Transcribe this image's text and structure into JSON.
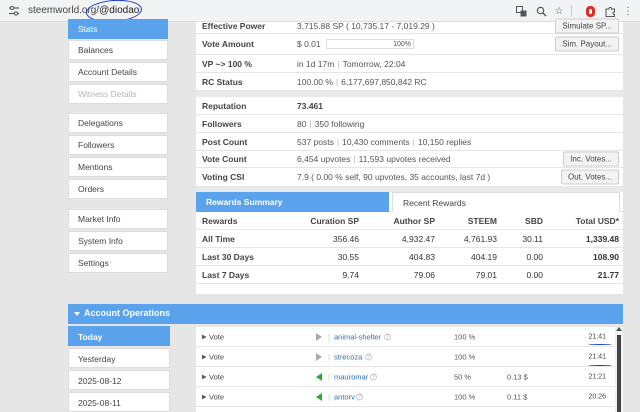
{
  "browser": {
    "url_host": "steemworld.org/",
    "url_path": "@diodao"
  },
  "sidebar": {
    "items": [
      {
        "label": "Stats"
      },
      {
        "label": "Balances"
      },
      {
        "label": "Account Details"
      },
      {
        "label": "Witness Details"
      },
      {
        "label": "Delegations"
      },
      {
        "label": "Followers"
      },
      {
        "label": "Mentions"
      },
      {
        "label": "Orders"
      },
      {
        "label": "Market Info"
      },
      {
        "label": "System Info"
      },
      {
        "label": "Settings"
      }
    ]
  },
  "stats": {
    "effective_power": {
      "label": "Effective Power",
      "value": "3,715.88 SP ( 10,735.17 - 7,019.29 )",
      "button": "Simulate SP..."
    },
    "vote_amount": {
      "label": "Vote Amount",
      "value": "$ 0.01",
      "percent": "100%",
      "button": "Sim. Payout..."
    },
    "vp": {
      "label": "VP ~> 100 %",
      "value": "in 1d 17m",
      "extra": "Tomorrow, 22:04"
    },
    "rc": {
      "label": "RC Status",
      "value": "100.00 %",
      "extra": "6,177,697,850,842 RC"
    },
    "reputation": {
      "label": "Reputation",
      "value": "73.461"
    },
    "followers": {
      "label": "Followers",
      "value": "80",
      "extra": "350 following"
    },
    "post_count": {
      "label": "Post Count",
      "value": "537 posts",
      "extra1": "10,430 comments",
      "extra2": "10,150 replies"
    },
    "vote_count": {
      "label": "Vote Count",
      "value": "6,454 upvotes",
      "extra": "11,593 upvotes received",
      "button": "Inc. Votes..."
    },
    "voting_csi": {
      "label": "Voting CSI",
      "value": "7.9 ( 0.00 % self, 90 upvotes, 35 accounts, last 7d )",
      "button": "Out. Votes..."
    }
  },
  "rewards": {
    "tabs": [
      "Rewards Summary",
      "Recent Rewards"
    ],
    "headers": [
      "Rewards",
      "Curation SP",
      "Author SP",
      "STEEM",
      "SBD",
      "Total USD",
      "*"
    ],
    "rows": [
      [
        "All Time",
        "356.46",
        "4,932.47",
        "4,761.93",
        "30.11",
        "1,339.48"
      ],
      [
        "Last 30 Days",
        "30.55",
        "404.83",
        "404.19",
        "0.00",
        "108.90"
      ],
      [
        "Last 7 Days",
        "9.74",
        "79.06",
        "79.01",
        "0.00",
        "21.77"
      ]
    ]
  },
  "operations": {
    "title": "Account Operations",
    "days": [
      "Today",
      "Yesterday",
      "2025-08-12",
      "2025-08-11"
    ],
    "rows": [
      {
        "type": "Vote",
        "direction": "out",
        "account": "animal-shelter",
        "pct": "100 %",
        "sp": "",
        "time": "21:41"
      },
      {
        "type": "Vote",
        "direction": "out",
        "account": "strecoza",
        "pct": "100 %",
        "sp": "",
        "time": "21:41"
      },
      {
        "type": "Vote",
        "direction": "in",
        "account": "mauromar",
        "pct": "50 %",
        "sp": "0.13 $",
        "time": "21:21"
      },
      {
        "type": "Vote",
        "direction": "in",
        "account": "antorv",
        "pct": "100 %",
        "sp": "0.11 $",
        "time": "20:26"
      }
    ]
  },
  "colors": {
    "accent": "#5aa3ec",
    "annotation": "#1f3fd6",
    "vote_in": "#2eab2e"
  },
  "icons": [
    "tune-icon",
    "translate-icon",
    "zoom-icon",
    "star-icon",
    "extension-icon",
    "puzzle-icon",
    "menu-icon"
  ]
}
